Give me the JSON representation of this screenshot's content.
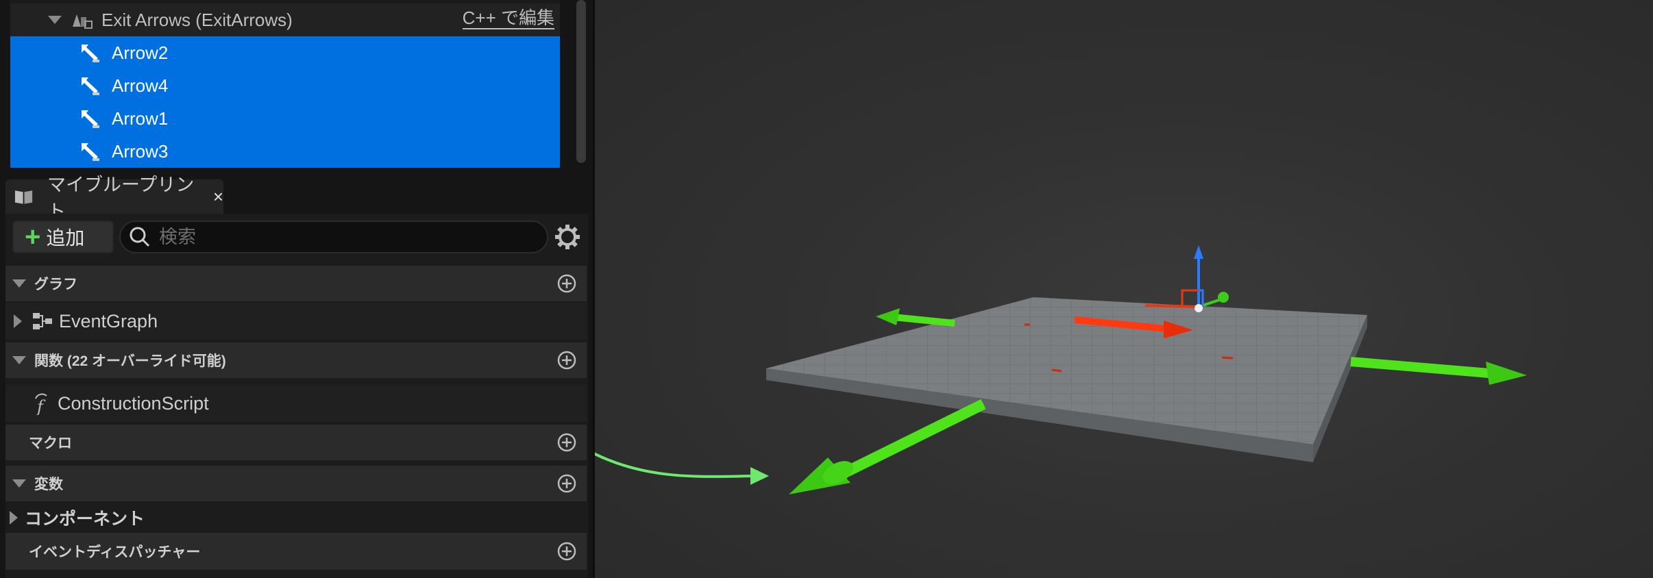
{
  "components": {
    "header_label": "Exit Arrows (ExitArrows)",
    "edit_link": "C++ で編集",
    "children": [
      {
        "label": "Arrow2"
      },
      {
        "label": "Arrow4"
      },
      {
        "label": "Arrow1"
      },
      {
        "label": "Arrow3"
      }
    ]
  },
  "my_blueprint": {
    "tab_label": "マイブループリント",
    "tab_close": "×",
    "add_label": "追加",
    "search_placeholder": "検索",
    "sections": {
      "graph": "グラフ",
      "event_graph": "EventGraph",
      "functions": "関数 (22 オーバーライド可能)",
      "construction_script": "ConstructionScript",
      "macros": "マクロ",
      "variables": "変数",
      "components": "コンポーネント",
      "event_dispatchers": "イベントディスパッチャー"
    }
  },
  "colors": {
    "selection": "#0070e0",
    "annotation_curve": "#6fe86f",
    "arrow_green": "#4fe31c",
    "arrow_red": "#ff3a10",
    "gizmo_blue": "#2a7bff"
  }
}
